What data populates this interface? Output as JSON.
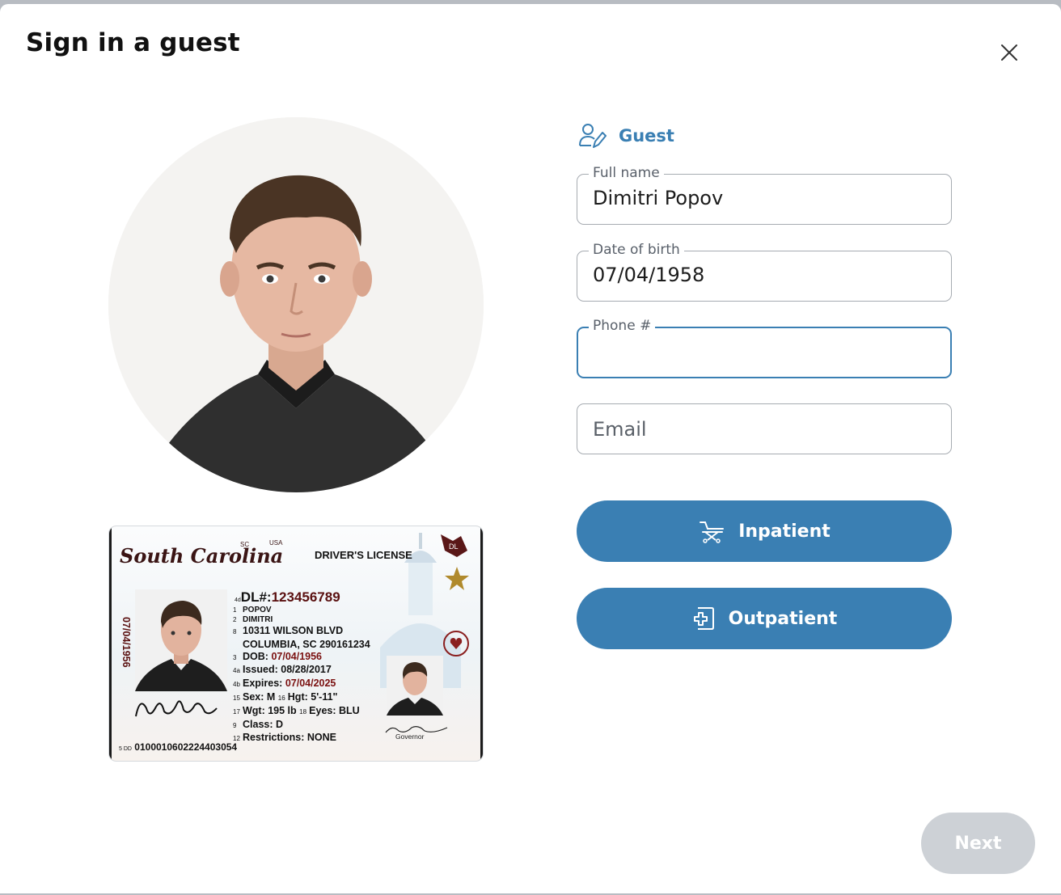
{
  "dialog": {
    "title": "Sign in a guest"
  },
  "section": {
    "label": "Guest"
  },
  "fields": {
    "full_name": {
      "label": "Full name",
      "value": "Dimitri Popov"
    },
    "dob": {
      "label": "Date of birth",
      "value": "07/04/1958"
    },
    "phone": {
      "label": "Phone #",
      "value": ""
    },
    "email": {
      "placeholder": "Email"
    }
  },
  "buttons": {
    "inpatient": "Inpatient",
    "outpatient": "Outpatient",
    "next": "Next"
  },
  "id_card": {
    "state": "South Carolina",
    "sc": "SC",
    "usa": "USA",
    "type": "DRIVER'S LICENSE",
    "badge": "DL",
    "dl_prefix": "4d",
    "dl_label": "DL#:",
    "dl_number": "123456789",
    "last_name": "POPOV",
    "first_name": "DIMITRI",
    "address1": "10311 WILSON BLVD",
    "address2": "COLUMBIA, SC 290161234",
    "dob_label": "DOB:",
    "dob": "07/04/1956",
    "issued_label": "Issued:",
    "issued": "08/28/2017",
    "expires_label": "Expires:",
    "expires": "07/04/2025",
    "sex": "Sex: M",
    "hgt": "Hgt: 5'-11\"",
    "wgt": "Wgt: 195 lb",
    "eyes": "Eyes: BLU",
    "class": "Class: D",
    "restrictions": "Restrictions: NONE",
    "vertical_dob": "07/04/1956",
    "dd_prefix": "5 DD",
    "dd_number": "0100010602224403054",
    "governor": "Governor",
    "field_numbers": {
      "n1": "1",
      "n2": "2",
      "n8": "8",
      "n3": "3",
      "n4a": "4a",
      "n4b": "4b",
      "n15": "15",
      "n16": "16",
      "n17": "17",
      "n18": "18",
      "n9": "9",
      "n12": "12"
    }
  },
  "colors": {
    "accent": "#3a7fb3",
    "disabled": "#cdd1d6",
    "card_maroon": "#5a1010"
  },
  "icons": {
    "close": "close-icon",
    "guest": "guest-edit-icon",
    "inpatient": "stretcher-icon",
    "outpatient": "medical-cross-icon"
  }
}
